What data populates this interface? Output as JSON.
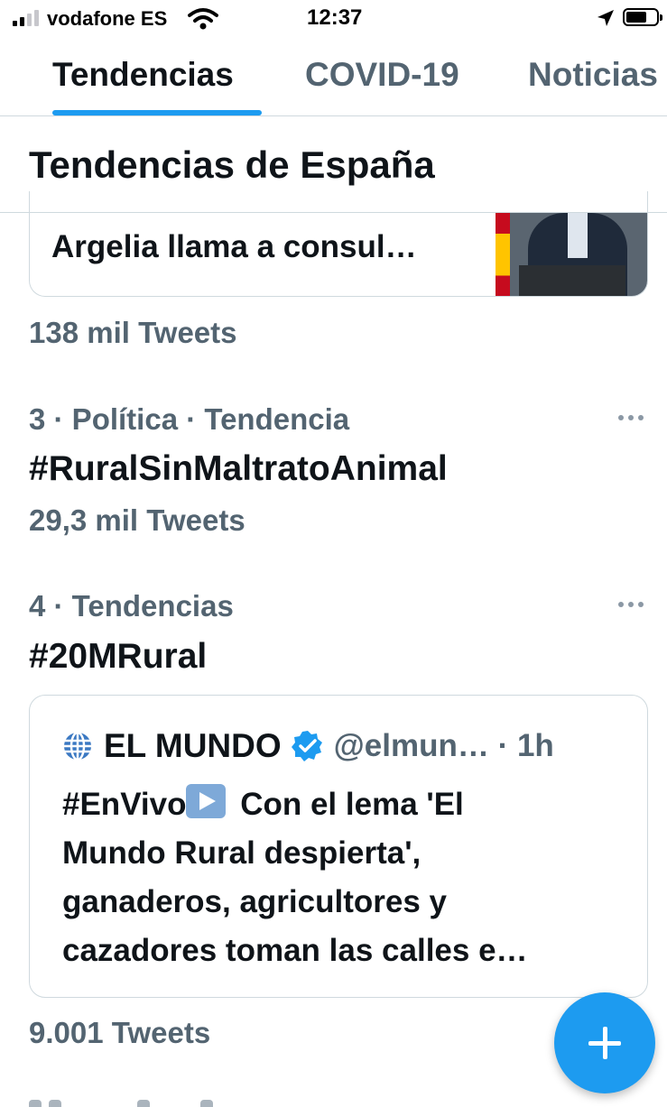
{
  "status_bar": {
    "carrier": "vodafone ES",
    "time": "12:37"
  },
  "tabs": [
    {
      "label": "Tendencias",
      "active": true
    },
    {
      "label": "COVID-19",
      "active": false
    },
    {
      "label": "Noticias",
      "active": false
    }
  ],
  "section": {
    "title": "Tendencias de España"
  },
  "trends": {
    "news_card_title": "Argelia llama a consul…",
    "news_count": "138 mil Tweets",
    "items": [
      {
        "rank_meta": "3 · Política · Tendencia",
        "name": "#RuralSinMaltratoAnimal",
        "count": "29,3 mil Tweets"
      },
      {
        "rank_meta": "4 · Tendencias",
        "name": "#20MRural",
        "count": "9.001 Tweets"
      }
    ]
  },
  "tweet": {
    "author": "EL MUNDO",
    "handle_time": "@elmun… · 1h",
    "hashtag": "#EnVivo",
    "text_line1_rest": " Con el lema 'El",
    "text_line2": "Mundo Rural despierta',",
    "text_line3": "ganaderos, agricultores y",
    "text_line4": "cazadores toman las calles e…"
  },
  "colors": {
    "accent": "#1d9bf0",
    "secondary_text": "#536471",
    "primary_text": "#0f1419",
    "border": "#cfd9de"
  },
  "icons": [
    "signal-icon",
    "wifi-icon",
    "location-arrow-icon",
    "battery-icon",
    "more-icon",
    "globe-icon",
    "verified-badge-icon",
    "play-emoji-icon",
    "plus-icon"
  ]
}
